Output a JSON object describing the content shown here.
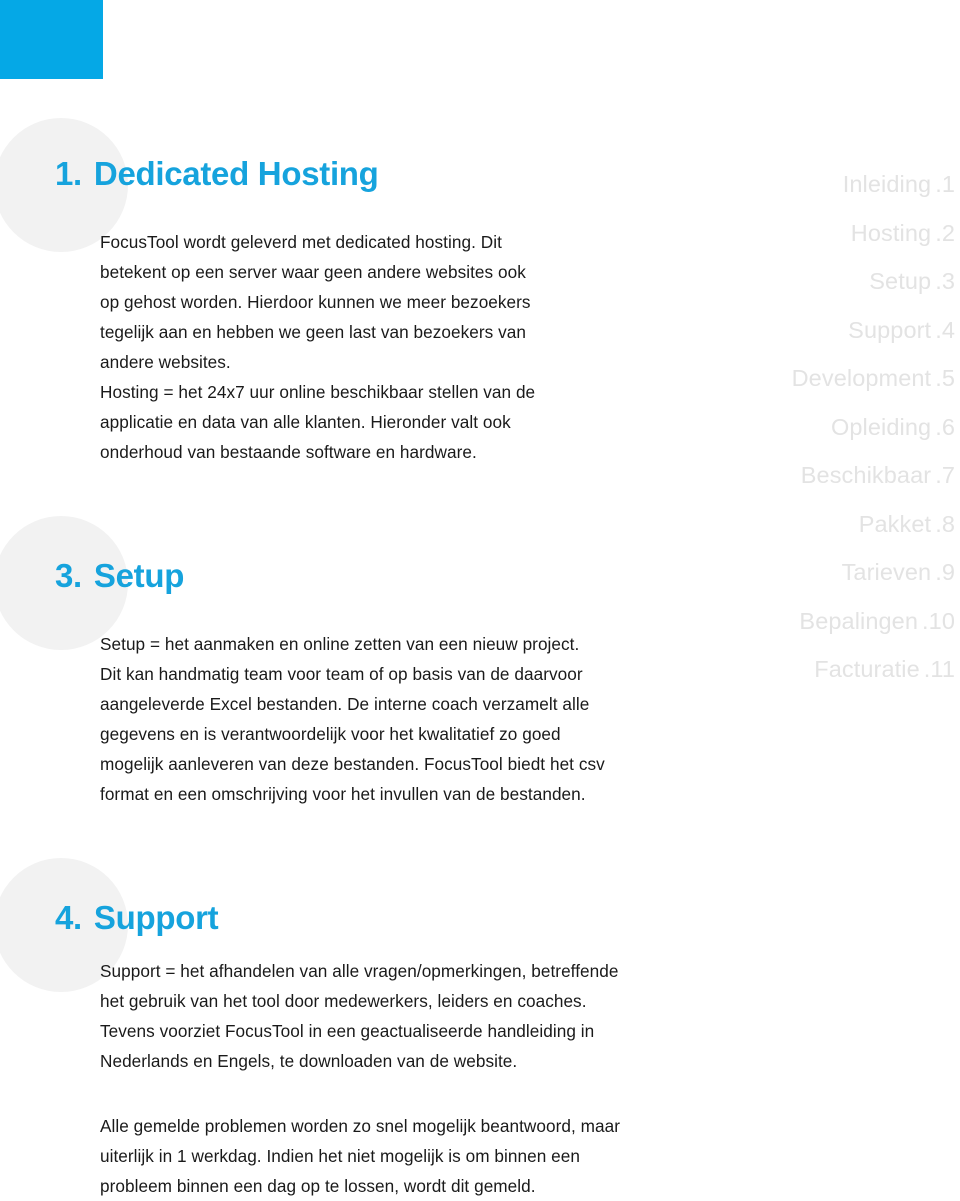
{
  "theme": {
    "accent_blue": "#05a8e6",
    "heading_blue": "#16a3dd",
    "circle_gray": "#f2f2f2",
    "index_gray": "#e3e3e3",
    "body_black": "#1a1a1a",
    "page_background": "#ffffff"
  },
  "sections": [
    {
      "number": "1.",
      "title": "Dedicated Hosting",
      "body": "FocusTool wordt geleverd met dedicated hosting. Dit\nbetekent op een server waar geen andere websites ook\nop gehost worden. Hierdoor kunnen we meer bezoekers\ntegelijk aan en hebben we geen last van bezoekers van\nandere websites.\nHosting = het 24x7 uur online beschikbaar stellen van de\napplicatie en data van alle klanten. Hieronder valt ook\nonderhoud van bestaande software en hardware."
    },
    {
      "number": "3.",
      "title": "Setup",
      "body": "Setup = het aanmaken en online zetten van een nieuw project.\nDit kan handmatig team voor team of op basis van de daarvoor\naangeleverde Excel bestanden. De interne coach verzamelt alle\ngegevens en is verantwoordelijk voor het kwalitatief zo goed\nmogelijk aanleveren van deze bestanden. FocusTool biedt het csv\nformat en een omschrijving voor het invullen  van de bestanden."
    },
    {
      "number": "4.",
      "title": "Support",
      "body": "Support = het afhandelen van alle vragen/opmerkingen, betreffende\nhet gebruik van het tool door medewerkers, leiders en coaches.\nTevens voorziet FocusTool in een geactualiseerde handleiding in\nNederlands en Engels, te downloaden van de website.",
      "body2": "Alle gemelde problemen worden zo snel mogelijk beantwoord, maar\nuiterlijk in 1 werkdag. Indien het niet mogelijk is om binnen een\nprobleem binnen een dag op te lossen, wordt dit gemeld."
    }
  ],
  "index_nav": {
    "items": [
      {
        "label": "Inleiding",
        "number": ".1"
      },
      {
        "label": "Hosting",
        "number": ".2"
      },
      {
        "label": "Setup",
        "number": ".3"
      },
      {
        "label": "Support",
        "number": ".4"
      },
      {
        "label": "Development",
        "number": ".5"
      },
      {
        "label": "Opleiding",
        "number": ".6"
      },
      {
        "label": "Beschikbaar",
        "number": ".7"
      },
      {
        "label": "Pakket",
        "number": ".8"
      },
      {
        "label": "Tarieven",
        "number": ".9"
      },
      {
        "label": "Bepalingen",
        "number": ".10"
      },
      {
        "label": "Facturatie",
        "number": ".11"
      }
    ]
  }
}
